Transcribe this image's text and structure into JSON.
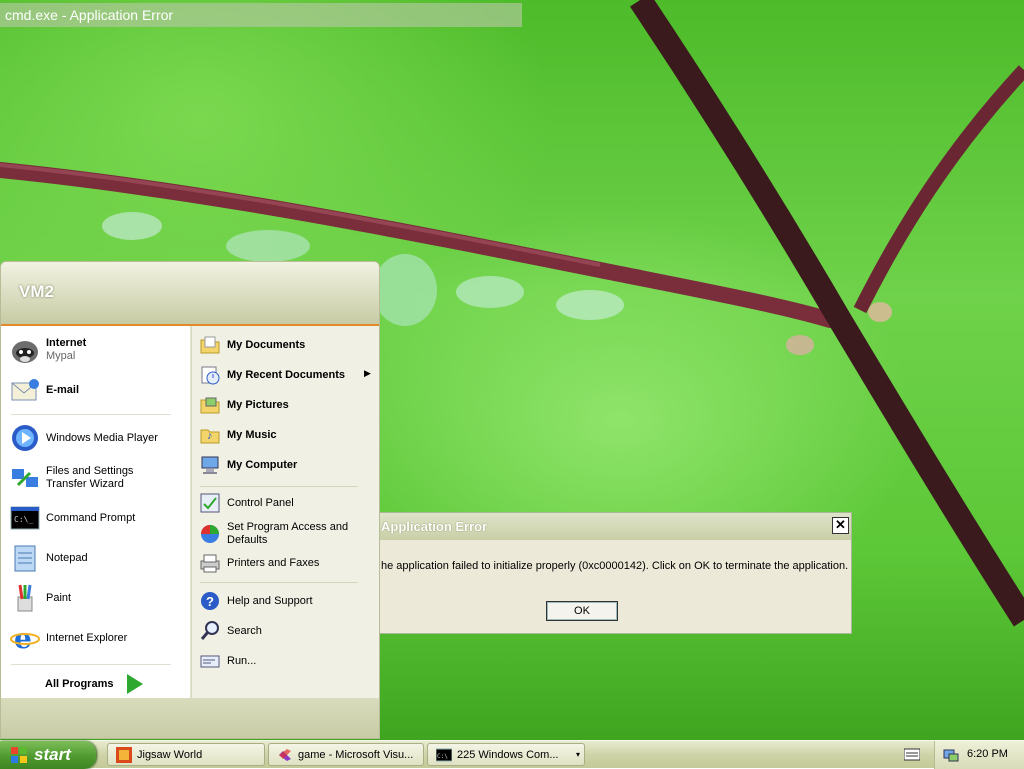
{
  "window_title": "cmd.exe - Application Error",
  "dialog": {
    "title": "Application Error",
    "message": "he application failed to initialize properly (0xc0000142). Click on OK to terminate the application.",
    "ok_label": "OK",
    "close_glyph": "✕"
  },
  "start_menu": {
    "user": "VM2",
    "left_items": [
      {
        "label": "Internet",
        "sublabel": "Mypal",
        "icon": "raccoon-browser-icon"
      },
      {
        "label": "E-mail",
        "icon": "envelope-icon"
      },
      {
        "label": "Windows Media Player",
        "icon": "media-player-icon"
      },
      {
        "label": "Files and Settings Transfer Wizard",
        "icon": "transfer-wizard-icon"
      },
      {
        "label": "Command Prompt",
        "icon": "cmd-icon"
      },
      {
        "label": "Notepad",
        "icon": "notepad-icon"
      },
      {
        "label": "Paint",
        "icon": "paint-icon"
      },
      {
        "label": "Internet Explorer",
        "icon": "ie-icon"
      }
    ],
    "all_programs": "All Programs",
    "right_items": [
      {
        "label": "My Documents",
        "icon": "folder-icon"
      },
      {
        "label": "My Recent Documents",
        "icon": "recent-docs-icon"
      },
      {
        "label": "My Pictures",
        "icon": "pictures-folder-icon"
      },
      {
        "label": "My Music",
        "icon": "music-folder-icon"
      },
      {
        "label": "My Computer",
        "icon": "computer-icon"
      },
      {
        "label": "Control Panel",
        "icon": "control-panel-icon"
      },
      {
        "label": "Set Program Access and Defaults",
        "icon": "program-defaults-icon"
      },
      {
        "label": "Printers and Faxes",
        "icon": "printer-icon"
      },
      {
        "label": "Help and Support",
        "icon": "help-icon"
      },
      {
        "label": "Search",
        "icon": "search-icon"
      },
      {
        "label": "Run...",
        "icon": "run-icon"
      }
    ],
    "submenu_arrow": "▶"
  },
  "taskbar": {
    "start_label": "start",
    "tasks": [
      {
        "label": "Jigsaw World",
        "icon": "jigsaw-icon"
      },
      {
        "label": "game - Microsoft Visu...",
        "icon": "visual-studio-icon"
      },
      {
        "label": "225 Windows Com...",
        "count": "225",
        "icon": "cmd-icon"
      }
    ],
    "clock": "6:20 PM",
    "dropdown_glyph": "▾"
  },
  "colors": {
    "accent_orange": "#e08a2c",
    "start_green": "#4f9a30",
    "taskbar": "#cfd4a8"
  }
}
